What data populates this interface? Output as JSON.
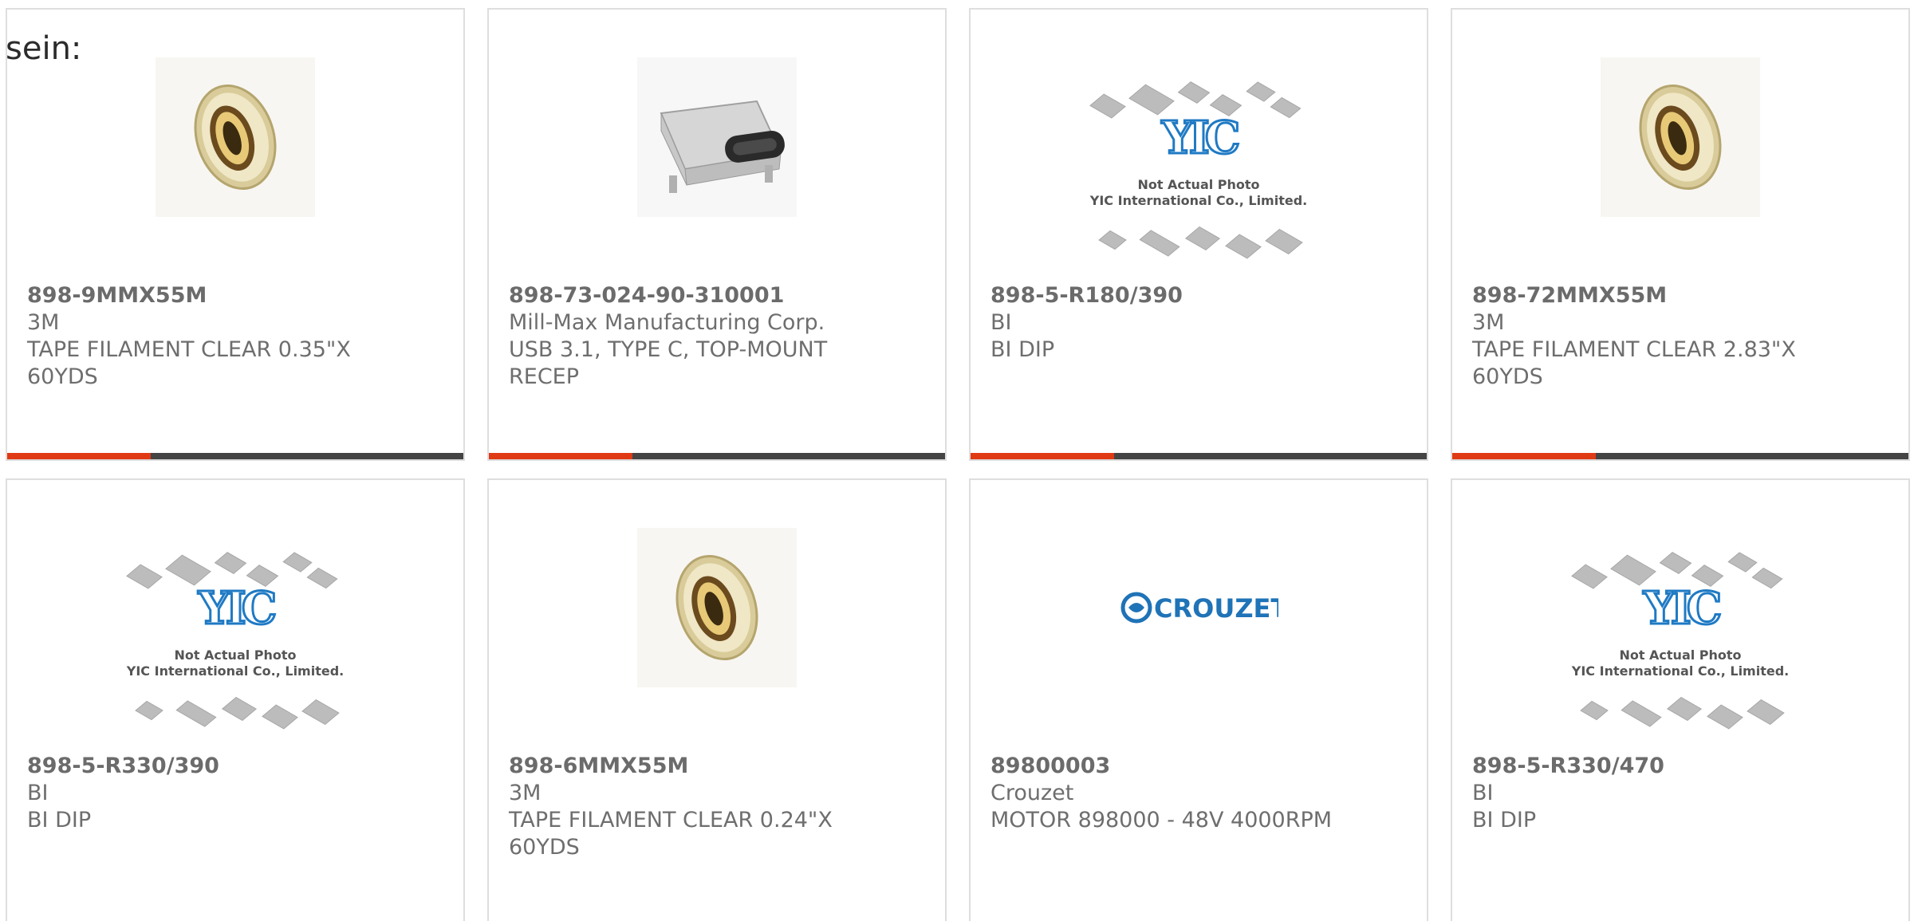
{
  "lead_text": "sein:",
  "colors": {
    "accent": "#e03a14",
    "bar": "#444444",
    "border": "#dedede",
    "text": "#6e6e6e"
  },
  "placeholder": {
    "line1": "Not Actual Photo",
    "line2": "YIC International Co., Limited."
  },
  "brand_logo": "CROUZET",
  "products": [
    {
      "part": "898-9MMX55M",
      "maker": "3M",
      "desc1": "TAPE FILAMENT CLEAR 0.35\"X",
      "desc2": "60YDS",
      "image": "tape-roll"
    },
    {
      "part": "898-73-024-90-310001",
      "maker": "Mill-Max Manufacturing Corp.",
      "desc1": "USB 3.1, TYPE C, TOP-MOUNT",
      "desc2": "RECEP",
      "image": "usb-c-connector"
    },
    {
      "part": "898-5-R180/390",
      "maker": "BI",
      "desc1": "BI DIP",
      "desc2": "",
      "image": "yic-placeholder"
    },
    {
      "part": "898-72MMX55M",
      "maker": "3M",
      "desc1": "TAPE FILAMENT CLEAR 2.83\"X",
      "desc2": "60YDS",
      "image": "tape-roll"
    },
    {
      "part": "898-5-R330/390",
      "maker": "BI",
      "desc1": "BI DIP",
      "desc2": "",
      "image": "yic-placeholder"
    },
    {
      "part": "898-6MMX55M",
      "maker": "3M",
      "desc1": "TAPE FILAMENT CLEAR 0.24\"X",
      "desc2": "60YDS",
      "image": "tape-roll"
    },
    {
      "part": "89800003",
      "maker": "Crouzet",
      "desc1": "MOTOR 898000 - 48V 4000RPM",
      "desc2": "",
      "image": "crouzet-logo"
    },
    {
      "part": "898-5-R330/470",
      "maker": "BI",
      "desc1": "BI DIP",
      "desc2": "",
      "image": "yic-placeholder"
    }
  ]
}
